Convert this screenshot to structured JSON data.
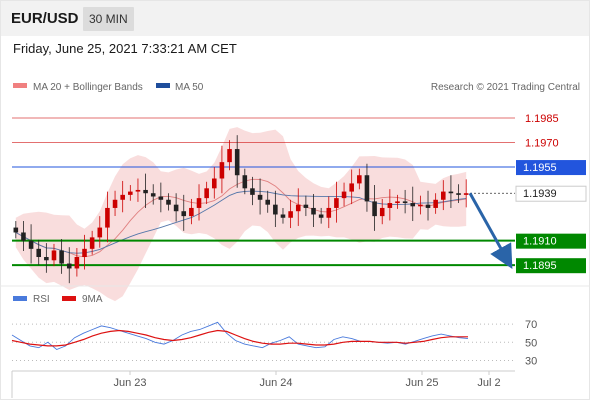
{
  "header": {
    "symbol": "EUR/USD",
    "timeframe": "30 MIN",
    "datetime": "Friday, June 25, 2021 7:33:21 AM CET"
  },
  "legend": {
    "ma20": "MA 20 + Bollinger Bands",
    "ma50": "MA 50",
    "credit": "Research © 2021 Trading Central",
    "rsi": "RSI",
    "rsi_ma": "9MA"
  },
  "colors": {
    "resistance": "#cc0000",
    "pivot": "#2255dd",
    "support": "#008800",
    "current": "#222222",
    "arrow": "#2a64a8",
    "candle_up": "#cc0000",
    "candle_down": "#222222",
    "bollinger": "#f8d4d4",
    "ma20": "#e08080",
    "ma50": "#5577aa"
  },
  "chart_data": [
    {
      "type": "candlestick",
      "title": "EUR/USD",
      "ylim": [
        1.1889,
        1.1996
      ],
      "levels": [
        {
          "value": 1.1985,
          "label": "1.1985",
          "kind": "resistance"
        },
        {
          "value": 1.197,
          "label": "1.1970",
          "kind": "resistance"
        },
        {
          "value": 1.1955,
          "label": "1.1955",
          "kind": "pivot"
        },
        {
          "value": 1.1939,
          "label": "1.1939",
          "kind": "current"
        },
        {
          "value": 1.191,
          "label": "1.1910",
          "kind": "support"
        },
        {
          "value": 1.1895,
          "label": "1.1895",
          "kind": "support"
        }
      ],
      "forecast": {
        "from": 1.1939,
        "to": 1.1895,
        "direction": "down"
      },
      "close_path": [
        1.1915,
        1.191,
        1.1905,
        1.19,
        1.1898,
        1.1904,
        1.1896,
        1.1893,
        1.19,
        1.1905,
        1.1912,
        1.1918,
        1.193,
        1.1935,
        1.1938,
        1.194,
        1.1941,
        1.1939,
        1.1937,
        1.1935,
        1.1932,
        1.1928,
        1.1925,
        1.193,
        1.1936,
        1.1942,
        1.1948,
        1.1958,
        1.1966,
        1.195,
        1.1942,
        1.1938,
        1.1935,
        1.1932,
        1.1926,
        1.1924,
        1.1928,
        1.1932,
        1.193,
        1.1926,
        1.1924,
        1.193,
        1.1936,
        1.194,
        1.1945,
        1.195,
        1.1934,
        1.1925,
        1.193,
        1.1933,
        1.1934,
        1.1933,
        1.1931,
        1.1932,
        1.193,
        1.1935,
        1.194,
        1.1939,
        1.1938,
        1.1939
      ],
      "x_ticks": [
        "Jun 23",
        "Jun 24",
        "Jun 25",
        "Jul 2"
      ]
    },
    {
      "type": "line",
      "title": "RSI",
      "ylim": [
        25,
        80
      ],
      "y_ticks": [
        70,
        50,
        30
      ],
      "series": [
        {
          "name": "RSI",
          "color": "#4a7adc",
          "values": [
            58,
            52,
            46,
            44,
            50,
            42,
            46,
            55,
            60,
            64,
            68,
            66,
            63,
            60,
            57,
            54,
            50,
            48,
            52,
            58,
            62,
            64,
            68,
            72,
            60,
            52,
            48,
            46,
            44,
            49,
            52,
            56,
            48,
            46,
            44,
            45,
            53,
            56,
            54,
            51,
            51,
            50,
            49,
            50,
            48,
            51,
            54,
            57,
            59,
            57,
            55,
            54
          ]
        },
        {
          "name": "9MA",
          "color": "#dd1111",
          "values": [
            52,
            50,
            48,
            47,
            46,
            46,
            47,
            50,
            53,
            57,
            60,
            62,
            63,
            62,
            60,
            58,
            55,
            53,
            52,
            53,
            55,
            58,
            61,
            63,
            62,
            58,
            54,
            51,
            49,
            48,
            48,
            49,
            49,
            48,
            47,
            47,
            48,
            50,
            51,
            51,
            51,
            50,
            50,
            50,
            49,
            50,
            51,
            53,
            55,
            56,
            56,
            56
          ]
        }
      ]
    }
  ]
}
